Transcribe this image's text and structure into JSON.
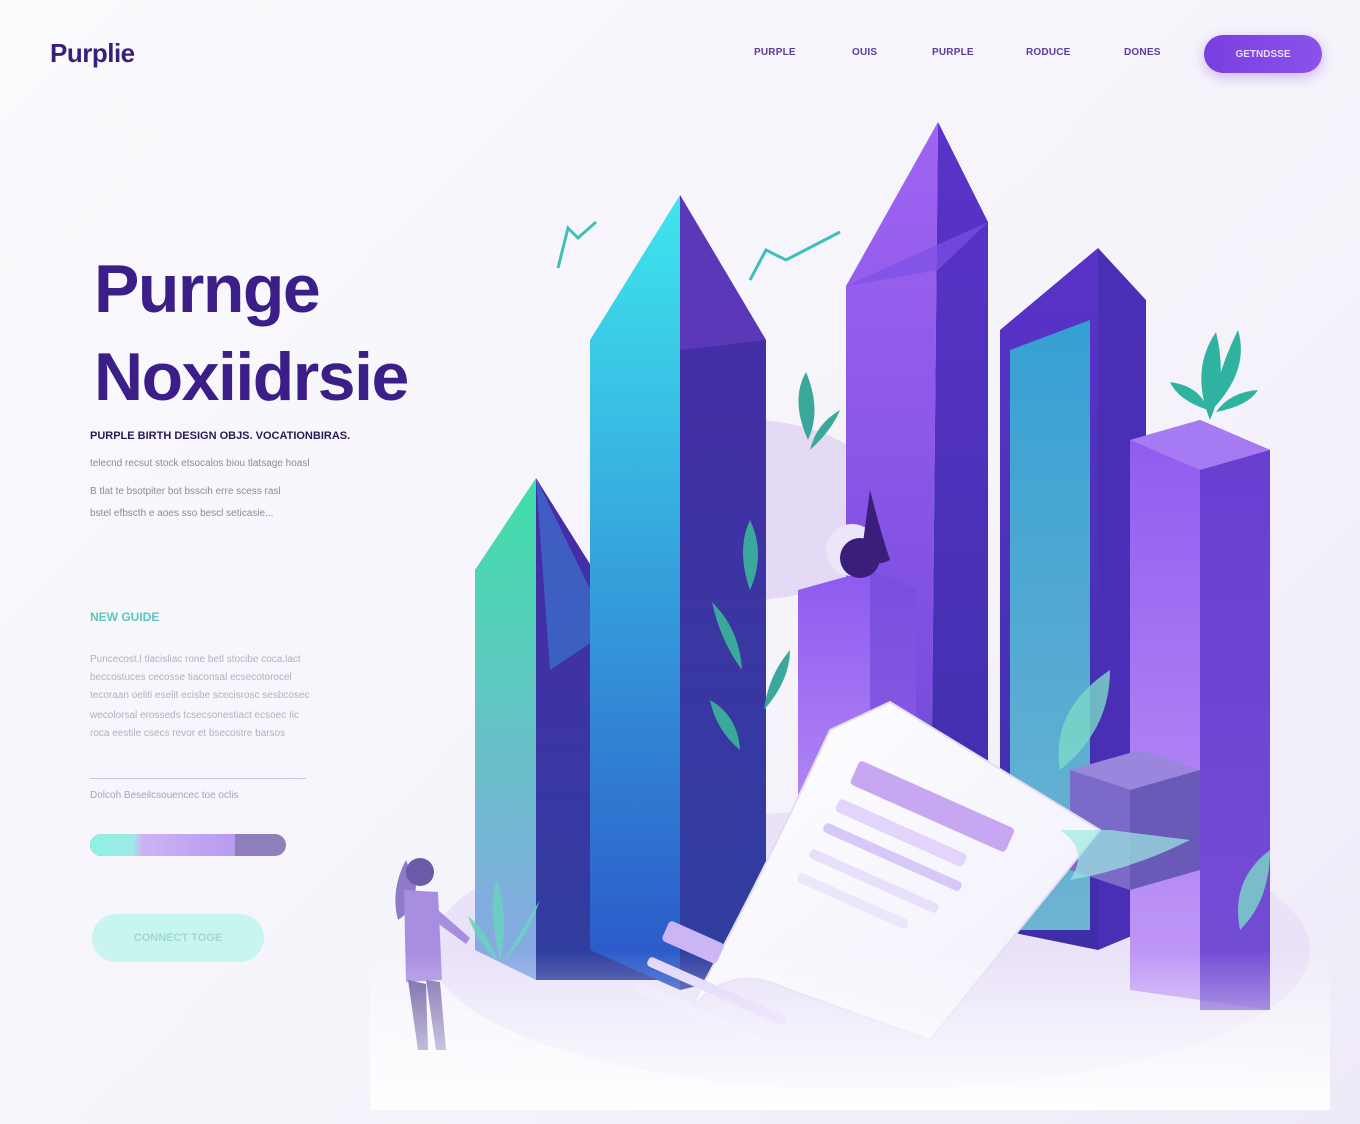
{
  "header": {
    "logo": "Purplie",
    "nav": [
      "PURPLE",
      "OUIS",
      "PURPLE",
      "RODUCE",
      "DONES"
    ],
    "cta": "GETNDSSE"
  },
  "hero": {
    "title_line1": "Purnge",
    "title_line2": "Noxiidrsie",
    "subtitle_bold": "PURPLE BIRTH DESIGN OBJS. VOCATIONBIRAS.",
    "subtitle_lines": [
      "telecnd recsut stock etsocalos biou tlatsage hoasl",
      "B  tlat te  bsotpiter bot bsscih erre scess rasl",
      "bstel efbscth e aoes sso bescl seticasie..."
    ]
  },
  "section": {
    "label": "NEW GUIDE",
    "paragraph": [
      "Puncecost.l tlacisliac rone betl stocibe coca.lact",
      "beccostuces  cecosse tiaconsal ecsecotorocel",
      "tecoraan oeliti eselit ecisbe scecisrosc sesbcosec",
      "wecolorsal erosseds tcsecsonestiact ecsoec Iic",
      "roca eestile csecs revor et bsecostre barsos"
    ]
  },
  "caption": "Dolcoh  Beseilcsouencec toe oclis",
  "progress": {
    "value": 0.74
  },
  "cta": "CONNECT TOGE",
  "colors": {
    "brand": "#3b1e87",
    "accent": "#7a3ee0",
    "teal": "#58c7bd",
    "mint": "#c9f5f0"
  },
  "icons": [
    "tower-illustration",
    "document-illustration",
    "person-illustration",
    "leaf-illustration"
  ]
}
